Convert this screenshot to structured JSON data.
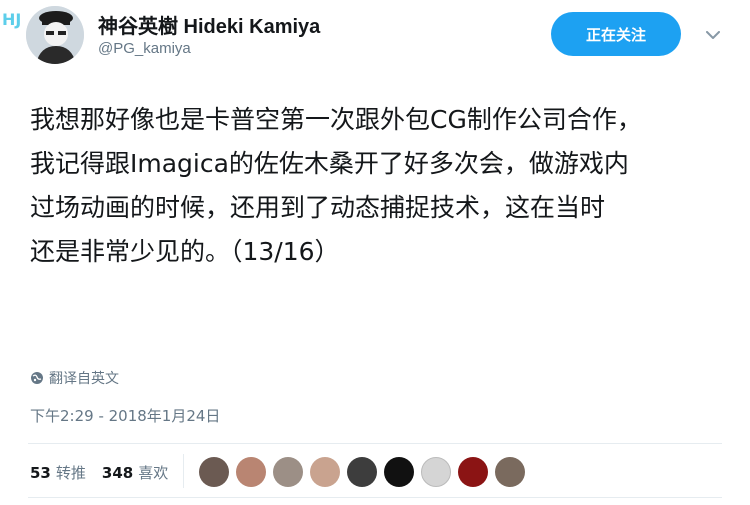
{
  "profile": {
    "display_name": "神谷英樹 Hideki Kamiya",
    "handle": "@PG_kamiya",
    "avatar_icon": "avatar-photo",
    "watermark_text": "HJ"
  },
  "follow_button": {
    "label": "正在关注"
  },
  "menu": {
    "icon": "chevron-down-icon"
  },
  "tweet": {
    "lines": [
      "我想那好像也是卡普空第一次跟外包CG制作公司合作，",
      "我记得跟Imagica的佐佐木桑开了好多次会，做游戏内",
      "过场动画的时候，还用到了动态捕捉技术，这在当时",
      "还是非常少见的。（13/16）"
    ]
  },
  "translate": {
    "label": "翻译自英文",
    "icon": "globe-icon"
  },
  "timestamp": "下午2:29 - 2018年1月24日",
  "stats": {
    "retweets": {
      "count": "53",
      "label": "转推"
    },
    "likes": {
      "count": "348",
      "label": "喜欢"
    }
  },
  "likers": {
    "colors": [
      "#6b5a52",
      "#b98572",
      "#9c8f86",
      "#c9a38f",
      "#3d3d3d",
      "#111111",
      "#d5d5d5",
      "#8b1414",
      "#7a6a5e"
    ]
  },
  "colors": {
    "accent": "#1da1f2",
    "text": "#14171a",
    "secondary": "#657786",
    "divider": "#e6ecf0"
  }
}
